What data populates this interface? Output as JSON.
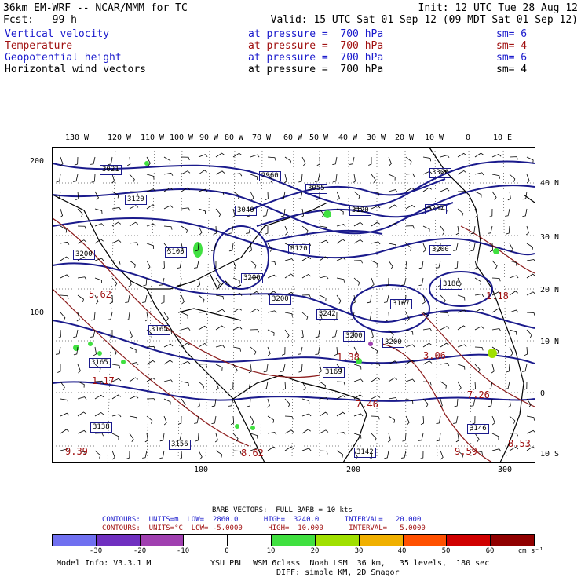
{
  "header": {
    "model": "36km EM-WRF -- NCAR/MMM for TC",
    "init": "Init: 12 UTC Tue 28 Aug 12",
    "fcst": "Fcst:   99 h",
    "valid": "Valid: 15 UTC Sat 01 Sep 12 (09 MDT Sat 01 Sep 12)"
  },
  "fields": [
    {
      "name": "Vertical velocity",
      "level": "at pressure =  700 hPa",
      "sm": "sm= 6",
      "color": "blue"
    },
    {
      "name": "Temperature",
      "level": "at pressure =  700 hPa",
      "sm": "sm= 4",
      "color": "red"
    },
    {
      "name": "Geopotential height",
      "level": "at pressure =  700 hPa",
      "sm": "sm= 6",
      "color": "blue"
    },
    {
      "name": "Horizontal wind vectors",
      "level": "at pressure =  700 hPa",
      "sm": "sm= 4",
      "color": "black"
    }
  ],
  "axes": {
    "lon_labels": [
      "130 W",
      "120 W",
      "110 W",
      "100 W",
      "90 W",
      "80 W",
      "70 W",
      "60 W",
      "50 W",
      "40 W",
      "30 W",
      "20 W",
      "10 W",
      "0",
      "10 E"
    ],
    "lat_labels": [
      "40 N",
      "30 N",
      "20 N",
      "10 N",
      "0",
      "10 S"
    ],
    "y_ticks": [
      "200",
      "100"
    ],
    "x_ticks": [
      "100",
      "200",
      "300"
    ]
  },
  "map_labels": {
    "height_boxes": [
      "3021",
      "2960",
      "3055",
      "3120",
      "3040",
      "3120",
      "3120",
      "3200",
      "3105",
      "3200",
      "3200",
      "3242",
      "3200",
      "3200",
      "3167",
      "3186",
      "3237",
      "3200",
      "3165",
      "3165",
      "3169",
      "3138",
      "3156",
      "3146",
      "3142",
      "3300"
    ],
    "temp_values": [
      "7.26",
      "7.46",
      "9.39",
      "8.62",
      "9.59",
      "8.53",
      "3.06",
      "1.38",
      "1.17",
      "1.18",
      "5.62"
    ]
  },
  "legend": {
    "barb": "BARB VECTORS:  FULL BARB = 10 kts",
    "contour1_prefix": "CONTOURS:  UNITS=m  LOW=  2860.0      HIGH=  3240.0      INTERVAL=   20.000",
    "contour2_prefix": "CONTOURS:  UNITS=°C  LOW= -5.0000      HIGH=  10.000      INTERVAL=   5.0000",
    "colorbar_labels": [
      "-30",
      "-20",
      "-10",
      "0",
      "10",
      "20",
      "30",
      "40",
      "50",
      "60"
    ],
    "colorbar_units": "cm s⁻¹",
    "colorbar_colors": [
      "#7070f0",
      "#7030c0",
      "#a040b0",
      "#ffffff",
      "#ffffff",
      "#40e040",
      "#a0e000",
      "#f0b000",
      "#ff5000",
      "#d00000",
      "#900000"
    ]
  },
  "footer": {
    "model_info": "Model Info: V3.3.1 M",
    "physics": "YSU PBL  WSM 6class  Noah LSM  36 km,   35 levels,  180 sec",
    "diff": "DIFF: simple KM, 2D Smagor"
  }
}
